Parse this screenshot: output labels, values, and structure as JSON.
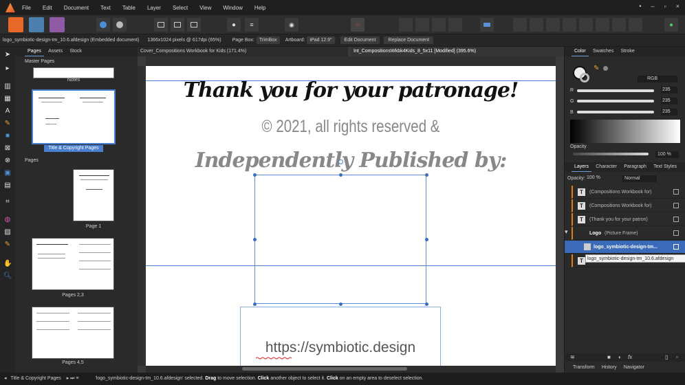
{
  "menu": [
    "File",
    "Edit",
    "Document",
    "Text",
    "Table",
    "Layer",
    "Select",
    "View",
    "Window",
    "Help"
  ],
  "window_controls": [
    "•",
    "–",
    "▫",
    "×"
  ],
  "context": {
    "file_label": "logo_symbiotic-design-tm_10.6.afdesign (Embedded document)",
    "pixels_label": "1366x1024 pixels @ 617dpi (65%)",
    "page_box_label": "Page Box:",
    "page_box_value": "TrimBox",
    "artboard_label": "Artboard:",
    "artboard_value": "iPad 12.9\"",
    "edit_button": "Edit Document",
    "replace_button": "Replace Document"
  },
  "left_panel": {
    "tabs": [
      "Pages",
      "Assets",
      "Stock"
    ],
    "master_header": "Master Pages",
    "pages_header": "Pages",
    "master_notes_label": "Notes",
    "master_selected_label": "Title & Copyright Pages",
    "page_labels": [
      "Page 1",
      "Pages 2,3",
      "Pages 4,5"
    ]
  },
  "doc_tabs": [
    {
      "label": "Cover_Compositions Workbook for Kids (171.4%)",
      "active": false
    },
    {
      "label": "Int_CompositionsWkbk4Kids_8_5x11 [Modified] (395.6%)",
      "active": true
    }
  ],
  "canvas": {
    "thank_you": "Thank you for your patronage!",
    "copyright": "© 2021, all rights reserved &",
    "published": "Independently Published by:",
    "url": "https://symbiotic.design"
  },
  "right_panel": {
    "color_tabs": [
      "Color",
      "Swatches",
      "Stroke"
    ],
    "color_model": "RGB",
    "channels": [
      {
        "label": "R",
        "value": "235"
      },
      {
        "label": "G",
        "value": "235"
      },
      {
        "label": "B",
        "value": "235"
      }
    ],
    "opacity_label": "Opacity",
    "opacity_value": "100 %",
    "layer_tabs": [
      "Layers",
      "Character",
      "Paragraph",
      "Text Styles"
    ],
    "layer_opacity_label": "Opacity:",
    "layer_opacity_value": "100 %",
    "blend_mode": "Normal",
    "layers": [
      {
        "name": "(Compositions Workbook for)",
        "kind": "text"
      },
      {
        "name": "(Compositions Workbook for)",
        "kind": "text"
      },
      {
        "name": "(Thank you for your patron)",
        "kind": "text"
      },
      {
        "name": "Logo",
        "suffix": "(Picture Frame)",
        "kind": "frame"
      },
      {
        "name": "logo_symbiotic-design-tm...",
        "kind": "image",
        "selected": true
      },
      {
        "name": "",
        "kind": "text"
      }
    ],
    "tooltip": "logo_symbiotic-design-tm_10.6.afdesign",
    "bottom_tabs": [
      "Transform",
      "History",
      "Navigator"
    ]
  },
  "status": {
    "page_label": "Title & Copyright Pages",
    "message_prefix": "'logo_symbiotic-design-tm_10.6.afdesign' selected. ",
    "drag_bold": "Drag",
    "drag_rest": " to move selection. ",
    "click_bold": "Click",
    "click_rest": " another object to select it. ",
    "click2_bold": "Click",
    "click2_rest": " on an empty area to deselect selection."
  },
  "colors": {
    "accent": "#4a7fd0",
    "selected_layer": "#3b6bb8",
    "layer_accent": "#e07b1e"
  }
}
